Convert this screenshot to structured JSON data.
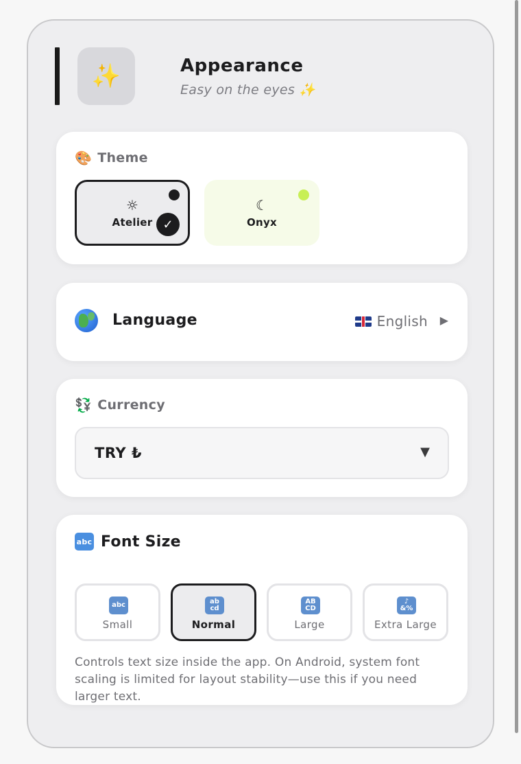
{
  "header": {
    "icon": "sparkles-icon",
    "icon_glyph": "✨",
    "title": "Appearance",
    "subtitle": "Easy on the eyes ✨"
  },
  "theme": {
    "label": "Theme",
    "label_icon": "🎨",
    "options": [
      {
        "name": "Atelier",
        "icon": "sun-icon",
        "glyph": "☼",
        "selected": true,
        "dot_color": "#1c1c1e"
      },
      {
        "name": "Onyx",
        "icon": "moon-icon",
        "glyph": "☾",
        "selected": false,
        "dot_color": "#c8ef55"
      }
    ],
    "check_glyph": "✓"
  },
  "language": {
    "label": "Language",
    "icon": "globe-icon",
    "value": "English",
    "flag": "uk-flag-icon",
    "chevron": "▶"
  },
  "currency": {
    "label": "Currency",
    "label_icon": "💱",
    "value": "TRY ₺",
    "caret": "▼"
  },
  "font_size": {
    "label": "Font Size",
    "label_icon_text": "abc",
    "options": [
      {
        "name": "Small",
        "icon_text": "abc",
        "selected": false
      },
      {
        "name": "Normal",
        "icon_text": "ab cd",
        "selected": true
      },
      {
        "name": "Large",
        "icon_text": "AB CD",
        "selected": false
      },
      {
        "name": "Extra Large",
        "icon_text": "♪ &%",
        "selected": false
      }
    ],
    "help": "Controls text size inside the app. On Android, system font scaling is limited for layout stability—use this if you need larger text."
  },
  "colors": {
    "accent_dark": "#1c1c1e",
    "onyx_accent": "#c8ef55",
    "panel_bg": "#eeeef0",
    "card_bg": "#ffffff"
  }
}
